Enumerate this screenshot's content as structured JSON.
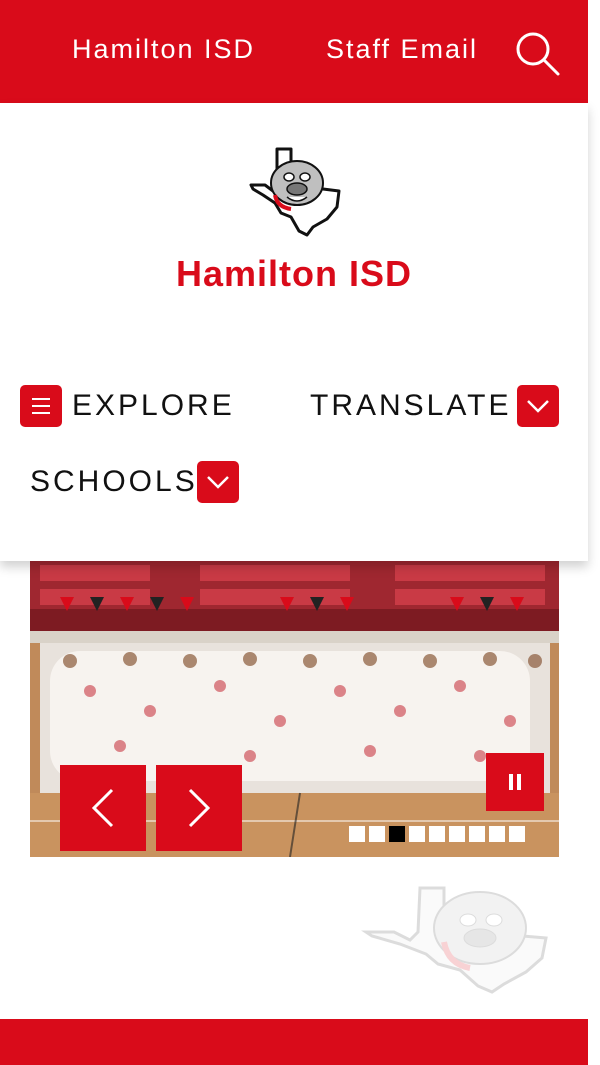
{
  "topbar": {
    "site_link": "Hamilton ISD",
    "staff_email": "Staff Email",
    "search_icon": "search-icon"
  },
  "header": {
    "logo_icon": "bulldog-texas-logo",
    "title": "Hamilton ISD"
  },
  "nav": {
    "explore": "EXPLORE",
    "translate": "TRANSLATE",
    "schools": "SCHOOLS"
  },
  "slider": {
    "slide_count": 9,
    "active_index": 2
  },
  "colors": {
    "brand_red": "#d90b1a",
    "white": "#ffffff"
  }
}
